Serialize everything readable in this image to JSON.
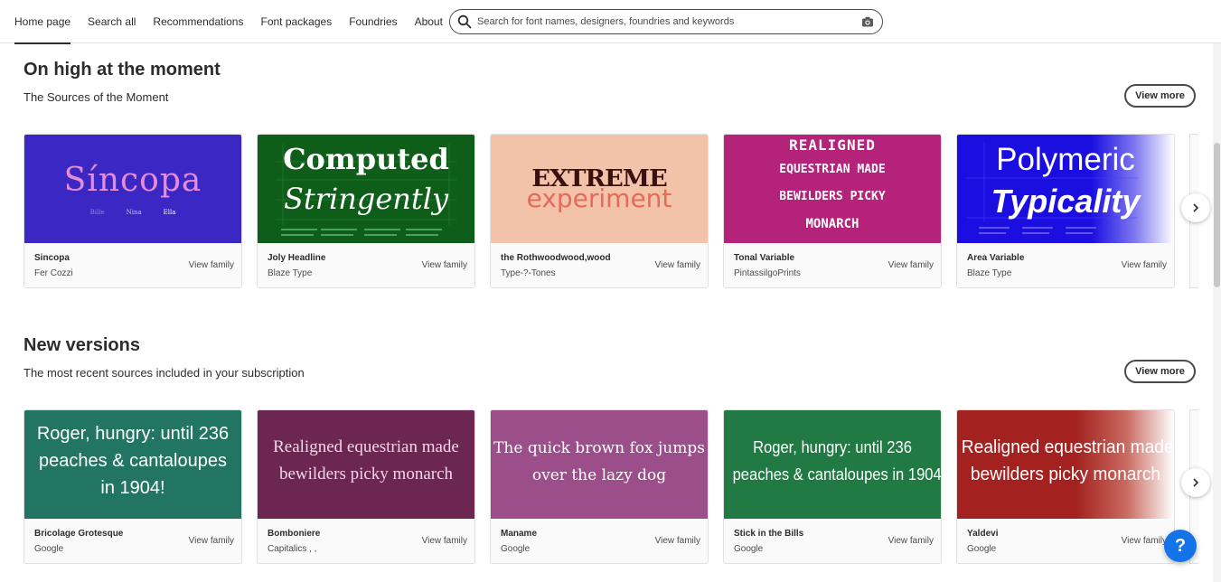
{
  "nav": {
    "items": [
      "Home page",
      "Search all",
      "Recommendations",
      "Font packages",
      "Foundries",
      "About"
    ],
    "active": "Home page"
  },
  "search": {
    "placeholder": "Search for font names, designers, foundries and keywords"
  },
  "sections": [
    {
      "title": "On high at the moment",
      "subtitle": "The Sources of the Moment",
      "view_more": "View more",
      "cards": [
        {
          "family": "Sincopa",
          "foundry": "Fer Cozzi",
          "view": "View family",
          "bg": "#3a27c4",
          "preview": [
            "Síncopa"
          ],
          "names": [
            "Bille",
            "Nina",
            "Ella"
          ]
        },
        {
          "family": "Joly Headline",
          "foundry": "Blaze Type",
          "view": "View family",
          "bg": "#0e5e1a",
          "preview": [
            "Computed",
            "Stringently"
          ]
        },
        {
          "family": "the Rothwoodwood,wood",
          "foundry": "Type-?-Tones",
          "view": "View family",
          "bg": "#f3c3a9",
          "preview": [
            "EXTREME",
            "experiment"
          ]
        },
        {
          "family": "Tonal Variable",
          "foundry": "PintassilgoPrints",
          "view": "View family",
          "bg": "#b4227a",
          "preview": [
            "REALIGNED",
            "EQUESTRIAN MADE",
            "BEWILDERS PICKY",
            "MONARCH"
          ]
        },
        {
          "family": "Area Variable",
          "foundry": "Blaze Type",
          "view": "View family",
          "bg": "#1a0fe0",
          "preview": [
            "Polymeric",
            "Typicality"
          ]
        }
      ]
    },
    {
      "title": "New versions",
      "subtitle": "The most recent sources included in your subscription",
      "view_more": "View more",
      "cards": [
        {
          "family": "Bricolage Grotesque",
          "foundry": "Google",
          "view": "View family",
          "bg": "#227563",
          "preview": [
            "Roger, hungry: until 236",
            "peaches & cantaloupes",
            "in 1904!"
          ]
        },
        {
          "family": "Bomboniere",
          "foundry": "Capitalics , ,",
          "view": "View family",
          "bg": "#6b2752",
          "preview": [
            "Realigned equestrian made",
            "bewilders picky monarch"
          ]
        },
        {
          "family": "Maname",
          "foundry": "Google",
          "view": "View family",
          "bg": "#9c4e8a",
          "preview": [
            "The quick brown fox jumps",
            "over the lazy dog"
          ]
        },
        {
          "family": "Stick in the Bills",
          "foundry": "Google",
          "view": "View family",
          "bg": "#217a44",
          "preview": [
            "Roger, hungry: until 236",
            "peaches & cantaloupes in 1904!"
          ]
        },
        {
          "family": "Yaldevi",
          "foundry": "Google",
          "view": "View family",
          "bg": "#a3221f",
          "preview": [
            "Realigned equestrian made",
            "bewilders picky monarch"
          ]
        }
      ]
    }
  ],
  "help": {
    "label": "?"
  }
}
